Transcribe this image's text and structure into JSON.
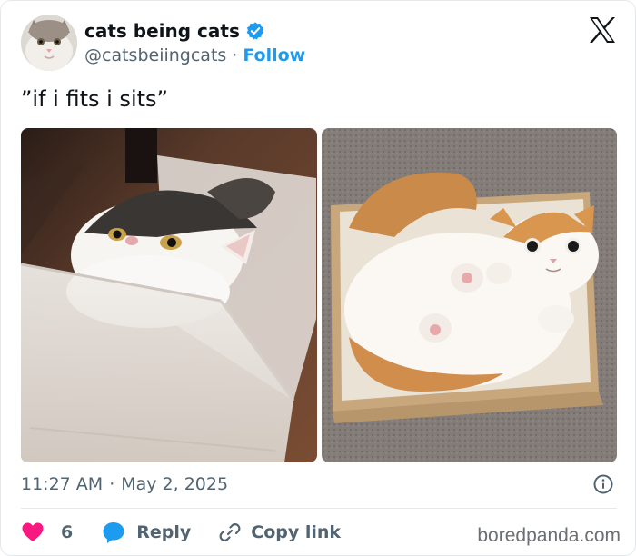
{
  "author": {
    "display_name": "cats being cats",
    "handle": "@catsbeiingcats",
    "separator": "·",
    "follow_label": "Follow",
    "verified_icon": "verified-badge-icon"
  },
  "platform_icon": "x-logo-icon",
  "tweet": {
    "text": "”if i fits i sits”",
    "images": [
      {
        "name": "cat-in-plastic-bin-photo"
      },
      {
        "name": "cat-in-cardboard-box-photo"
      }
    ]
  },
  "meta": {
    "time": "11:27 AM",
    "separator": "·",
    "date": "May 2, 2025",
    "info_icon": "info-icon"
  },
  "actions": {
    "like_count": "6",
    "reply_label": "Reply",
    "copy_link_label": "Copy link"
  },
  "watermark": "boredpanda.com",
  "colors": {
    "accent": "#1d9bf0",
    "like": "#f91880",
    "text_secondary": "#536471",
    "divider": "#e6e9ec"
  }
}
